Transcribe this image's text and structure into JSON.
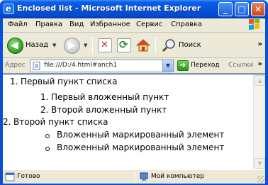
{
  "window": {
    "title": "Enclosed list - Microsoft Internet Explorer",
    "title_icon": "ie-icon",
    "controls": {
      "minimize": "_",
      "maximize": "□",
      "close": "✕"
    }
  },
  "menu": {
    "items": [
      "Файл",
      "Правка",
      "Вид",
      "Избранное",
      "Сервис",
      "Справка"
    ],
    "logo": "windows-flag-icon"
  },
  "toolbar": {
    "back_label": "Назад",
    "search_label": "Поиск",
    "more": "»"
  },
  "address_bar": {
    "label": "Адрес",
    "value": "file:///D:/4.html#anch1",
    "go_label": "Переход",
    "links_label": "Ссылки",
    "more": "»"
  },
  "content": {
    "items": [
      {
        "marker": "1.",
        "text": "Первый пункт списка",
        "children": [
          {
            "marker": "1.",
            "text": "Первый вложенный пункт"
          },
          {
            "marker": "2.",
            "text": "Второй вложенный пункт"
          }
        ]
      },
      {
        "marker": "2.",
        "text": "Второй пункт списка",
        "children": [
          {
            "marker": "circle",
            "text": "Вложенный маркированный элемент"
          },
          {
            "marker": "circle",
            "text": "Вложенный маркированный элемент"
          }
        ]
      }
    ]
  },
  "status_bar": {
    "text": "Готово",
    "zone": "Мой компьютер"
  },
  "colors": {
    "title_bar": "#0655dc",
    "chrome": "#ece9d8",
    "close_button": "#c9441b"
  }
}
